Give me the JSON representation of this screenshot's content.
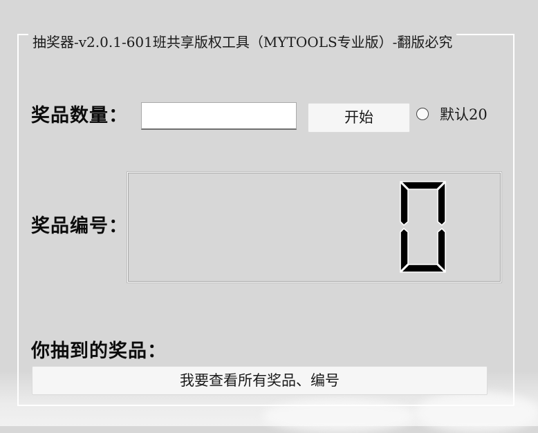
{
  "window": {
    "group_title": "抽奖器-v2.0.1-601班共享版权工具（MYTOOLS专业版）-翻版必究"
  },
  "form": {
    "quantity_label": "奖品数量：",
    "quantity_value": "",
    "start_button": "开始",
    "default_option_label": "默认20",
    "default_option_checked": false,
    "number_label": "奖品编号：",
    "display_value": "0",
    "result_label": "你抽到的奖品：",
    "view_all_button": "我要查看所有奖品、编号"
  },
  "colors": {
    "background": "#d7d7d7",
    "lcd_segment": "#000000",
    "lcd_outline": "#ffffff",
    "button_face": "#f6f6f6"
  }
}
